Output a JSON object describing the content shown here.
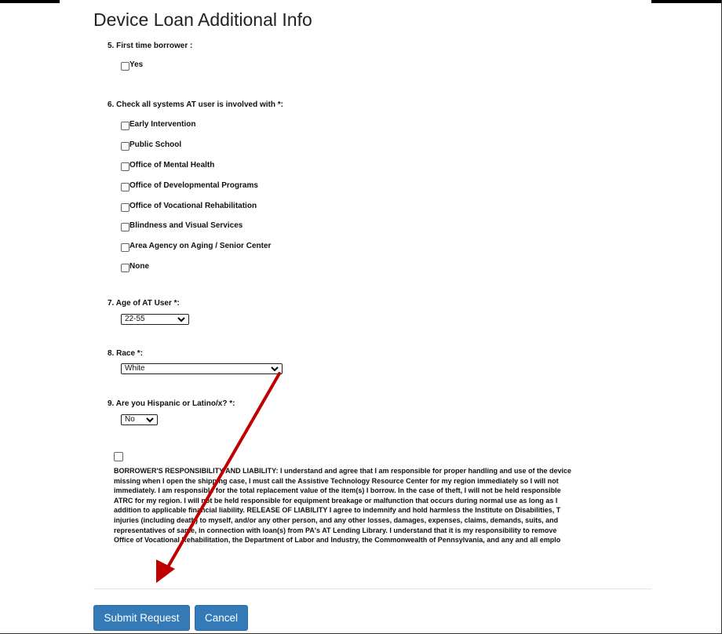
{
  "page": {
    "title": "Device Loan Additional Info",
    "accent_color": "#337ab7",
    "annotation_color": "#c00000"
  },
  "questions": {
    "first_time": {
      "label": "5. First time borrower :",
      "options": [
        "Yes"
      ]
    },
    "systems": {
      "label": "6. Check all systems AT user is involved with *:",
      "options": [
        "Early Intervention",
        "Public School",
        "Office of Mental Health",
        "Office of Developmental Programs",
        "Office of Vocational Rehabilitation",
        "Blindness and Visual Services",
        "Area Agency on Aging / Senior Center",
        "None"
      ]
    },
    "age": {
      "label": "7. Age of AT User *:",
      "selected": "22-55"
    },
    "race": {
      "label": "8. Race *:",
      "selected": "White"
    },
    "hispanic": {
      "label": "9. Are you Hispanic or Latino/x? *:",
      "selected": "No"
    }
  },
  "agreement": {
    "lines": [
      "BORROWER'S RESPONSIBILITY AND LIABILITY: I understand and agree that I am responsible for proper handling and use of the device",
      "missing when I open the shipping case, I must call the Assistive Technology Resource Center for my region immediately so I will not",
      "immediately. I am responsible for the total replacement value of the item(s) I borrow. In the case of theft, I will not be held responsible",
      "ATRC for my region. I will not be held responsible for equipment breakage or malfunction that occurs during normal use as long as I",
      "addition to applicable financial liability. RELEASE OF LIABILITY I agree to indemnify and hold harmless the Institute on Disabilities, T",
      "injuries (including death) to myself, and/or any other person, and any other losses, damages, expenses, claims, demands, suits, and",
      "representatives of same, in connection with loan(s) from PA's AT Lending Library. I understand that it is my responsibility to remove",
      "Office of Vocational Rehabilitation, the Department of Labor and Industry, the Commonwealth of Pennsylvania, and any and all emplo"
    ]
  },
  "buttons": {
    "submit": "Submit Request",
    "cancel": "Cancel"
  }
}
